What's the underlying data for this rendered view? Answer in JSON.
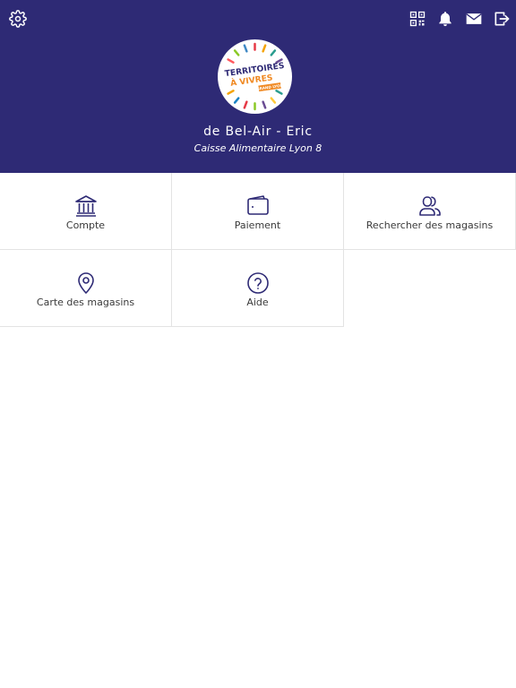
{
  "header": {
    "background": "#2e2a75",
    "icons": {
      "settings": "gear-icon",
      "qr": "qr-code-icon",
      "notifications": "bell-icon",
      "messages": "envelope-icon",
      "logout": "logout-icon"
    },
    "logo": {
      "line1": "TERRITOIRES",
      "line2": "À VIVRES",
      "line3": "GRAND LYON"
    },
    "user_name": "de Bel-Air - Eric",
    "user_org": "Caisse Alimentaire Lyon 8"
  },
  "menu": {
    "accent": "#2e2a75",
    "items": [
      {
        "label": "Compte",
        "icon": "bank-icon"
      },
      {
        "label": "Paiement",
        "icon": "wallet-icon"
      },
      {
        "label": "Rechercher des magasins",
        "icon": "users-icon"
      },
      {
        "label": "Carte des magasins",
        "icon": "map-pin-icon"
      },
      {
        "label": "Aide",
        "icon": "help-circle-icon"
      }
    ]
  }
}
